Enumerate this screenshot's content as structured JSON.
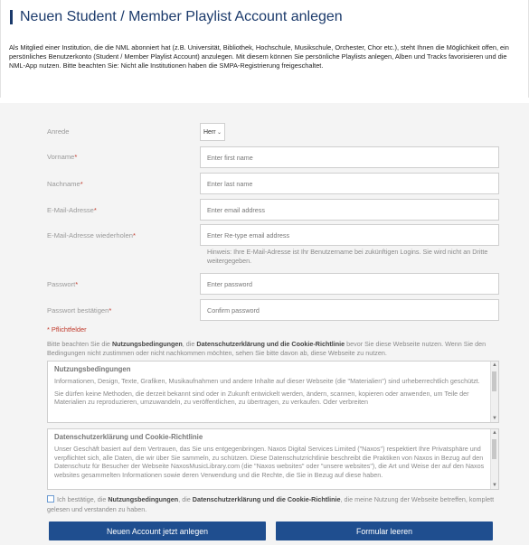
{
  "header": {
    "title": "Neuen Student / Member Playlist Account anlegen",
    "intro": "Als Mitglied einer Institution, die die NML abonniert hat (z.B. Universität, Bibliothek, Hochschule, Musikschule, Orchester, Chor etc.), steht Ihnen die Möglichkeit offen, ein persönliches Benutzerkonto (Student / Member Playlist Account) anzulegen. Mit diesem können Sie persönliche Playlists anlegen, Alben und Tracks favorisieren und die NML-App nutzen. Bitte beachten Sie: Nicht alle Institutionen haben die SMPA-Registrierung freigeschaltet."
  },
  "form": {
    "anrede_label": "Anrede",
    "anrede_value": "Herr",
    "vorname_label": "Vorname",
    "vorname_placeholder": "Enter first name",
    "nachname_label": "Nachname",
    "nachname_placeholder": "Enter last name",
    "email_label": "E-Mail-Adresse",
    "email_placeholder": "Enter email address",
    "email_repeat_label": "E-Mail-Adresse wiederholen",
    "email_repeat_placeholder": "Enter Re-type email address",
    "email_hint": "Hinweis: Ihre E-Mail-Adresse ist Ihr Benutzername bei zukünftigen Logins. Sie wird nicht an Dritte weitergegeben.",
    "passwort_label": "Passwort",
    "passwort_placeholder": "Enter password",
    "passwort_confirm_label": "Passwort bestätigen",
    "passwort_confirm_placeholder": "Confirm password",
    "required_marker": "*",
    "pflichtfelder": "* Pflichtfelder"
  },
  "notice": {
    "part1": "Bitte beachten Sie die ",
    "link1": "Nutzungsbedingungen",
    "part2": ", die ",
    "link2": "Datenschutzerklärung und die Cookie-Richtlinie",
    "part3": " bevor Sie diese Webseite nutzen. Wenn Sie den Bedingungen nicht zustimmen oder nicht nachkommen möchten, sehen Sie bitte davon ab, diese Webseite zu nutzen."
  },
  "terms_box": {
    "title": "Nutzungsbedingungen",
    "para1": "Informationen, Design, Texte, Grafiken, Musikaufnahmen und andere Inhalte auf dieser Webseite (die \"Materialien\") sind urheberrechtlich geschützt.",
    "para2": "Sie dürfen keine Methoden, die derzeit bekannt sind oder in Zukunft entwickelt werden, ändern, scannen, kopieren oder anwenden, um Teile der Materialien zu reproduzieren, umzuwandeln, zu veröffentlichen, zu übertragen, zu verkaufen. Oder verbreiten"
  },
  "privacy_box": {
    "title": "Datenschutzerklärung und Cookie-Richtlinie",
    "para1": "Unser Geschäft basiert auf dem Vertrauen, das Sie uns entgegenbringen. Naxos Digital Services Limited (\"Naxos\") respektiert Ihre Privatsphäre und verpflichtet sich, alle Daten, die wir über Sie sammeln, zu schützen. Diese Datenschutzrichtlinie beschreibt die Praktiken von Naxos in Bezug auf den Datenschutz für Besucher der Webseite NaxosMusicLibrary.com (die \"Naxos websites\" oder \"unsere websites\"), die Art und Weise der auf den Naxos websites gesammelten Informationen sowie deren Verwendung und die Rechte, die Sie in Bezug auf diese haben."
  },
  "consent": {
    "part1": "Ich bestätige, die ",
    "link1": "Nutzungsbedingungen",
    "part2": ", die ",
    "link2": "Datenschutzerklärung und die Cookie-Richtlinie",
    "part3": ", die meine Nutzung der Webseite betreffen, komplett gelesen und verstanden zu haben."
  },
  "buttons": {
    "create": "Neuen Account jetzt anlegen",
    "clear": "Formular leeren"
  },
  "colors": {
    "brand": "#1b3a6b",
    "button": "#1f4e8f",
    "required": "#c0392b"
  }
}
